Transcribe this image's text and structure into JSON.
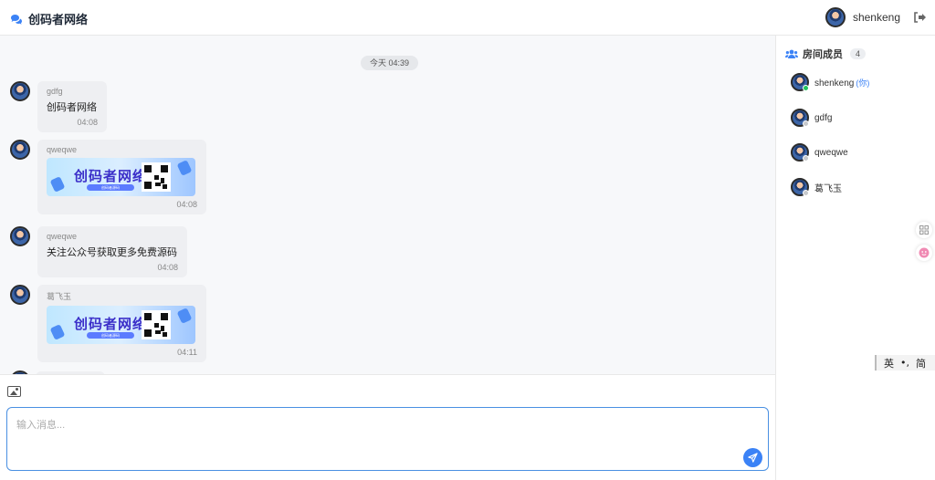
{
  "app": {
    "title": "创码者网络"
  },
  "user": {
    "name": "shenkeng"
  },
  "chat": {
    "time_divider": "今天 04:39",
    "messages": [
      {
        "sender": "gdfg",
        "text": "创码者网络",
        "time": "04:08"
      },
      {
        "sender": "qweqwe",
        "banner": {
          "title": "创码者网络",
          "subtitle": "创码者源码"
        },
        "time": "04:08"
      },
      {
        "sender": "qweqwe",
        "text": "关注公众号获取更多免费源码",
        "time": "04:08"
      },
      {
        "sender": "葛飞玉",
        "banner": {
          "title": "创码者网络",
          "subtitle": "创码者源码"
        },
        "time": "04:11"
      }
    ]
  },
  "composer": {
    "placeholder": "输入消息..."
  },
  "members": {
    "title": "房间成员",
    "count": "4",
    "you_label": "(你)",
    "list": [
      {
        "name": "shenkeng",
        "online": true
      },
      {
        "name": "gdfg",
        "online": false
      },
      {
        "name": "qweqwe",
        "online": false
      },
      {
        "name": "葛飞玉",
        "online": false
      }
    ]
  },
  "ime": {
    "lang": "英",
    "punct": "•,",
    "script": "简"
  },
  "colors": {
    "accent": "#3b82f6",
    "online": "#22c55e"
  }
}
